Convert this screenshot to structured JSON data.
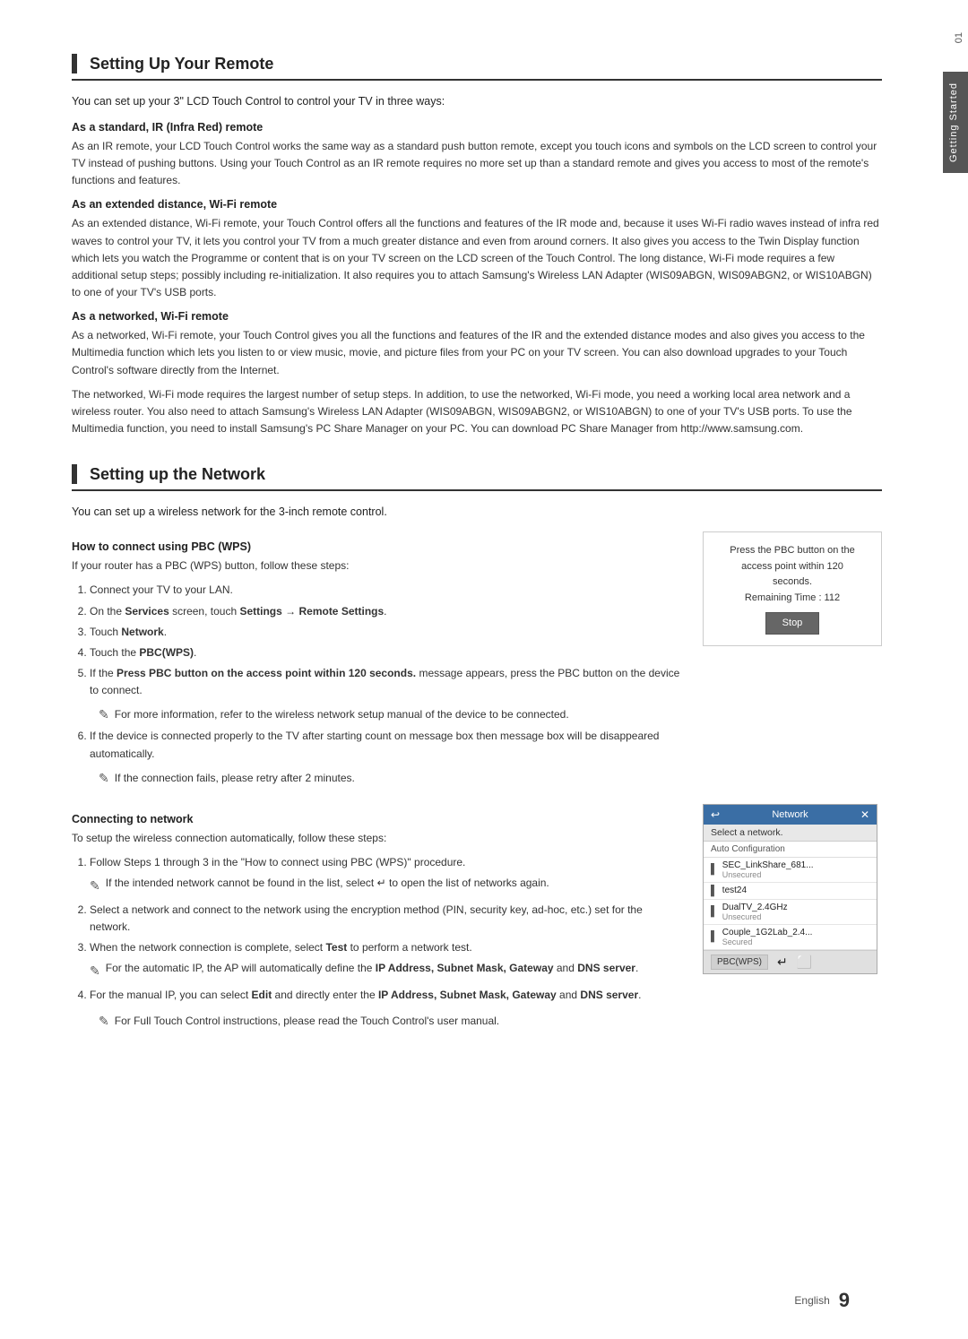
{
  "page": {
    "side_tab": {
      "number": "01",
      "label": "Getting Started"
    },
    "section1": {
      "title": "Setting Up Your Remote",
      "intro": "You can set up your 3\" LCD Touch Control to control your TV in three ways:",
      "subsections": [
        {
          "heading": "As a standard, IR (Infra Red) remote",
          "body": "As an IR remote, your LCD Touch Control works the same way as a standard push button remote, except you touch icons and symbols on the LCD screen to control your TV instead of pushing buttons. Using your Touch Control as an IR remote requires no more set up than a standard remote and gives you access to most of the remote's functions and features."
        },
        {
          "heading": "As an extended distance, Wi-Fi remote",
          "body": "As an extended distance, Wi-Fi remote, your Touch Control offers all the functions and features of the IR mode and, because it uses Wi-Fi radio waves instead of infra red waves to control your TV, it lets you control your TV from a much greater distance and even from around corners. It also gives you access to the Twin Display function which lets you watch the Programme or content that is on your TV screen on the LCD screen of the Touch Control. The long distance, Wi-Fi mode requires a few additional setup steps; possibly including re-initialization. It also requires you to attach Samsung's Wireless LAN Adapter (WIS09ABGN, WIS09ABGN2, or WIS10ABGN) to one of your TV's USB ports."
        },
        {
          "heading": "As a networked, Wi-Fi remote",
          "body1": "As a networked, Wi-Fi remote, your Touch Control gives you all the functions and features of the IR and the extended distance modes and also gives you access to the Multimedia function which lets you listen to or view music, movie, and picture files from your PC on your TV screen. You can also download upgrades to your Touch Control's software directly from the Internet.",
          "body2": "The networked, Wi-Fi mode requires the largest number of setup steps. In addition, to use the networked, Wi-Fi mode, you need a working local area network and a wireless router. You also need to attach Samsung's Wireless LAN Adapter (WIS09ABGN, WIS09ABGN2, or WIS10ABGN) to one of your TV's USB ports. To use the Multimedia function, you need to install Samsung's PC Share Manager on your PC. You can download PC Share Manager from http://www.samsung.com."
        }
      ]
    },
    "section2": {
      "title": "Setting up the Network",
      "intro": "You can set up a wireless network for the 3-inch remote control.",
      "pbc_section": {
        "heading": "How to connect using PBC (WPS)",
        "intro": "If your router has a PBC (WPS) button, follow these steps:",
        "steps": [
          "Connect your TV to your LAN.",
          "On the Services screen, touch Settings → Remote Settings.",
          "Touch Network.",
          "Touch the PBC(WPS).",
          "If the Press PBC button on the access point within 120 seconds. message appears, press the PBC button on the device to connect.",
          "If the device is connected properly to the TV after starting count on message box then message box will be disappeared automatically."
        ],
        "notes": [
          "For more information, refer to the wireless network setup manual of the device to be connected.",
          "If the connection fails, please retry after 2 minutes."
        ],
        "stop_box": {
          "line1": "Press the PBC button on the",
          "line2": "access point within 120",
          "line3": "seconds.",
          "line4": "Remaining Time : 112",
          "button_label": "Stop"
        }
      },
      "connecting_section": {
        "heading": "Connecting to network",
        "intro": "To setup the wireless connection automatically, follow these steps:",
        "steps": [
          {
            "text": "Follow Steps 1 through 3 in the \"How to connect using PBC (WPS)\" procedure.",
            "note": "If the intended network cannot be found in the list, select ↵ to open the list of networks again."
          },
          {
            "text": "Select a network and connect to the network using the encryption method (PIN, security key, ad-hoc, etc.) set for the network.",
            "note": null
          },
          {
            "text": "When the network connection is complete, select Test to perform a network test.",
            "note": "For the automatic IP, the AP will automatically define the IP Address, Subnet Mask, Gateway and DNS server."
          },
          {
            "text": "For the manual IP, you can select Edit and directly enter the IP Address, Subnet Mask, Gateway and DNS server.",
            "note": null
          }
        ],
        "footer_note": "For Full Touch Control instructions, please read the Touch Control's user manual.",
        "network_dialog": {
          "title": "Network",
          "sub_label": "Select a network.",
          "auto_label": "Auto Configuration",
          "items": [
            {
              "name": "SEC_LinkShare_681...",
              "sub": "Unsecured"
            },
            {
              "name": "test24",
              "sub": ""
            },
            {
              "name": "DualTV_2.4GHz",
              "sub": "Unsecured"
            },
            {
              "name": "Couple_1G2Lab_2.4...",
              "sub": "Secured"
            }
          ],
          "footer_btn": "PBC(WPS)"
        }
      }
    },
    "footer": {
      "language": "English",
      "page_number": "9"
    }
  }
}
